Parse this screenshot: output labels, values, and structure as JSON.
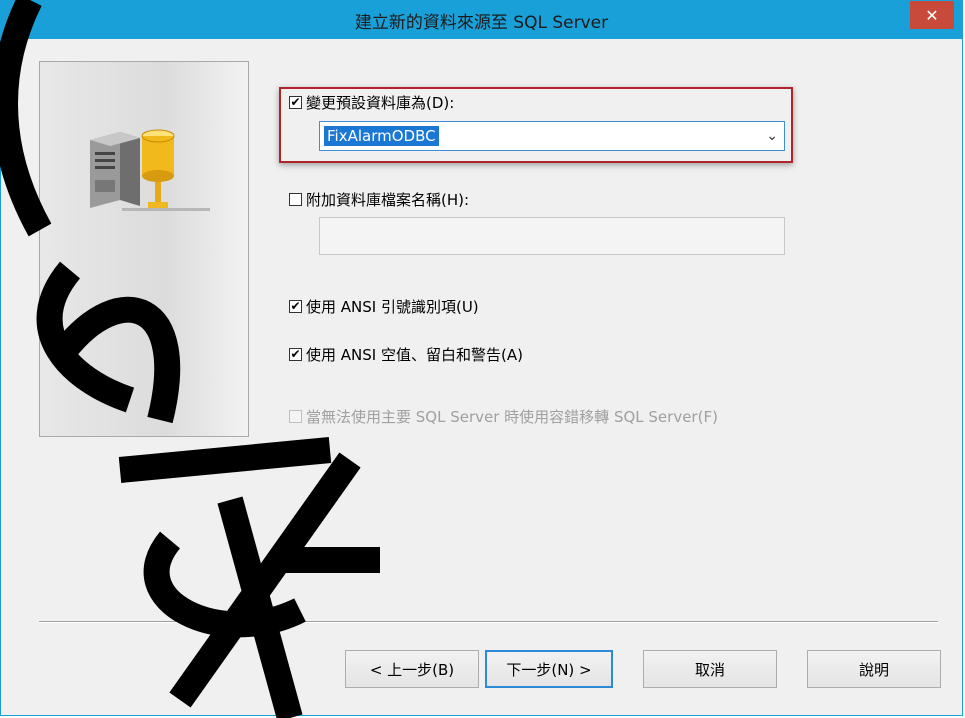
{
  "window": {
    "title": "建立新的資料來源至 SQL Server",
    "close_label": "✕"
  },
  "options": {
    "change_default_db": {
      "label": "變更預設資料庫為(D):",
      "checked": true
    },
    "default_db_value": "FixAlarmODBC",
    "attach_db_file": {
      "label": "附加資料庫檔案名稱(H):",
      "checked": false
    },
    "attach_db_value": "",
    "ansi_quoted": {
      "label": "使用 ANSI 引號識別項(U)",
      "checked": true
    },
    "ansi_nulls": {
      "label": "使用 ANSI 空值、留白和警告(A)",
      "checked": true
    },
    "failover": {
      "label": "當無法使用主要 SQL Server 時使用容錯移轉 SQL Server(F)",
      "checked": false,
      "disabled": true
    }
  },
  "buttons": {
    "back": "< 上一步(B)",
    "next": "下一步(N) >",
    "cancel": "取消",
    "help": "說明"
  },
  "colors": {
    "titlebar": "#1aa0d8",
    "close": "#c74a3a",
    "highlight": "#b0252a",
    "selection": "#1a77d4"
  }
}
